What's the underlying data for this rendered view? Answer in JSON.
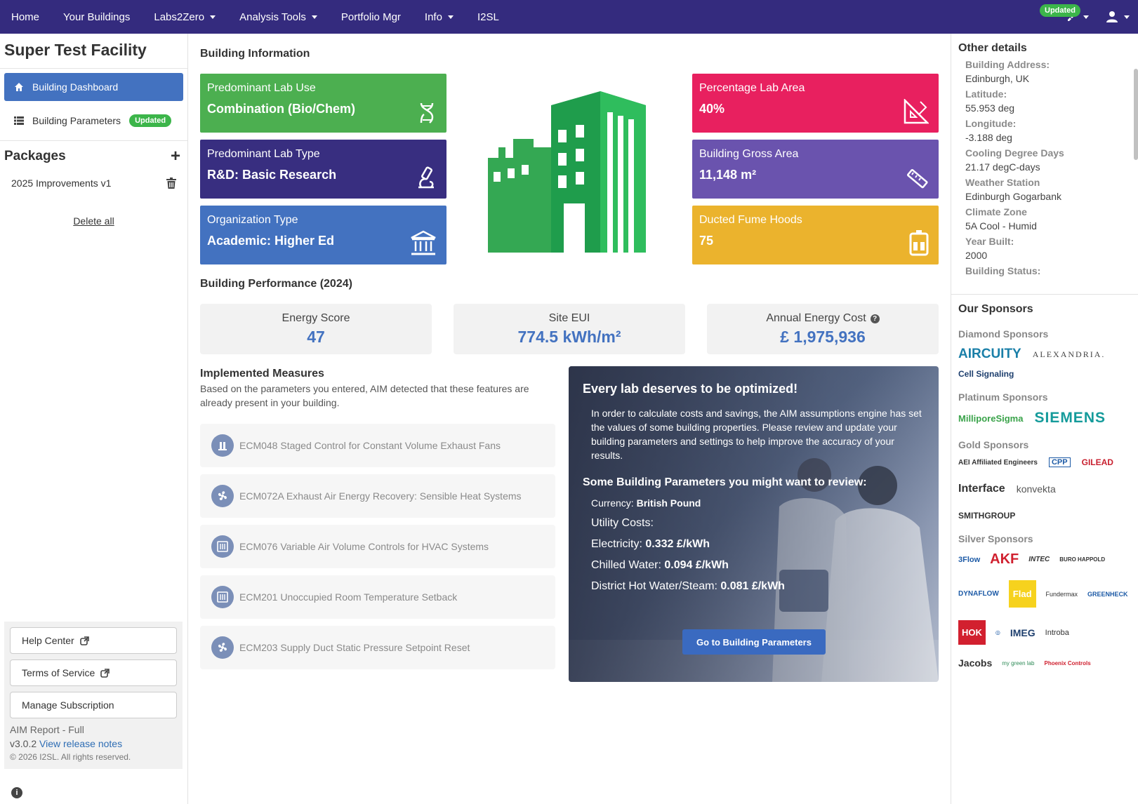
{
  "nav": {
    "items": [
      {
        "label": "Home",
        "dropdown": false
      },
      {
        "label": "Your Buildings",
        "dropdown": false
      },
      {
        "label": "Labs2Zero",
        "dropdown": true
      },
      {
        "label": "Analysis Tools",
        "dropdown": true
      },
      {
        "label": "Portfolio Mgr",
        "dropdown": false
      },
      {
        "label": "Info",
        "dropdown": true
      },
      {
        "label": "I2SL",
        "dropdown": false
      }
    ],
    "updated_badge": "Updated"
  },
  "sidebar": {
    "facility_title": "Super Test Facility",
    "nav": {
      "dashboard": "Building Dashboard",
      "parameters": "Building Parameters",
      "parameters_badge": "Updated"
    },
    "packages_title": "Packages",
    "package_name": "2025 Improvements v1",
    "delete_all": "Delete all",
    "help_center": "Help Center",
    "terms": "Terms of Service",
    "manage_subscription": "Manage Subscription",
    "report_label": "AIM Report - Full",
    "version": "v3.0.2",
    "release_notes": "View release notes",
    "copyright": "© 2026 I2SL. All rights reserved."
  },
  "main": {
    "building_info_title": "Building Information",
    "cards": {
      "lab_use": {
        "label": "Predominant Lab Use",
        "value": "Combination (Bio/Chem)"
      },
      "lab_type": {
        "label": "Predominant Lab Type",
        "value": "R&D: Basic Research"
      },
      "org_type": {
        "label": "Organization Type",
        "value": "Academic: Higher Ed"
      },
      "pct_lab": {
        "label": "Percentage Lab Area",
        "value": "40%"
      },
      "gross_area": {
        "label": "Building Gross Area",
        "value": "11,148 m²"
      },
      "fume_hoods": {
        "label": "Ducted Fume Hoods",
        "value": "75"
      }
    },
    "performance_title": "Building Performance (2024)",
    "performance": {
      "energy_score_label": "Energy Score",
      "energy_score": "47",
      "site_eui_label": "Site EUI",
      "site_eui": "774.5 kWh/m²",
      "annual_cost_label": "Annual Energy Cost",
      "annual_cost": "£ 1,975,936"
    },
    "measures_title": "Implemented Measures",
    "measures_desc": "Based on the parameters you entered, AIM detected that these features are already present in your building.",
    "measures": [
      "ECM048 Staged Control for Constant Volume Exhaust Fans",
      "ECM072A Exhaust Air Energy Recovery: Sensible Heat Systems",
      "ECM076 Variable Air Volume Controls for HVAC Systems",
      "ECM201 Unoccupied Room Temperature Setback",
      "ECM203 Supply Duct Static Pressure Setpoint Reset"
    ],
    "promo": {
      "title": "Every lab deserves to be optimized!",
      "body": "In order to calculate costs and savings, the AIM assumptions engine has set the values of some building properties. Please review and update your building parameters and settings to help improve the accuracy of your results.",
      "subtitle": "Some Building Parameters you might want to review:",
      "currency_label": "Currency:",
      "currency_value": "British Pound",
      "utility_label": "Utility Costs:",
      "electricity_label": "Electricity:",
      "electricity_value": "0.332 £/kWh",
      "chilled_label": "Chilled Water:",
      "chilled_value": "0.094 £/kWh",
      "district_label": "District Hot Water/Steam:",
      "district_value": "0.081 £/kWh",
      "button": "Go to Building Parameters"
    }
  },
  "right": {
    "other_details_title": "Other details",
    "details": [
      {
        "label": "Building Address:",
        "value": "Edinburgh, UK"
      },
      {
        "label": "Latitude:",
        "value": "55.953 deg"
      },
      {
        "label": "Longitude:",
        "value": "-3.188 deg"
      },
      {
        "label": "Cooling Degree Days",
        "value": "21.17 degC-days"
      },
      {
        "label": "Weather Station",
        "value": "Edinburgh Gogarbank"
      },
      {
        "label": "Climate Zone",
        "value": "5A Cool - Humid"
      },
      {
        "label": "Year Built:",
        "value": "2000"
      },
      {
        "label": "Building Status:",
        "value": ""
      }
    ],
    "sponsors_title": "Our Sponsors",
    "tiers": {
      "diamond": "Diamond Sponsors",
      "platinum": "Platinum Sponsors",
      "gold": "Gold Sponsors",
      "silver": "Silver Sponsors"
    },
    "logos": {
      "aircuity": "AIRCUITY",
      "alexandria": "ALEXANDRIA.",
      "cell_signaling": "Cell Signaling",
      "millipore": "MilliporeSigma",
      "siemens": "SIEMENS",
      "aei": "AEI Affiliated Engineers",
      "cpp": "CPP",
      "gilead": "GILEAD",
      "interface": "Interface",
      "konvekta": "konvekta",
      "smithgroup": "SMITHGROUP",
      "threeflow": "3Flow",
      "akf": "AKF",
      "intec": "INTEC",
      "buro": "BURO HAPPOLD",
      "dynaflow": "DYNAFLOW",
      "flad": "Flad",
      "fundermax": "Fundermax",
      "greenheck": "GREENHECK",
      "hok": "HOK",
      "imeg": "IMEG",
      "introba": "Introba",
      "jacobs": "Jacobs",
      "mygreenlab": "my green lab",
      "phoenix": "Phoenix Controls"
    }
  }
}
